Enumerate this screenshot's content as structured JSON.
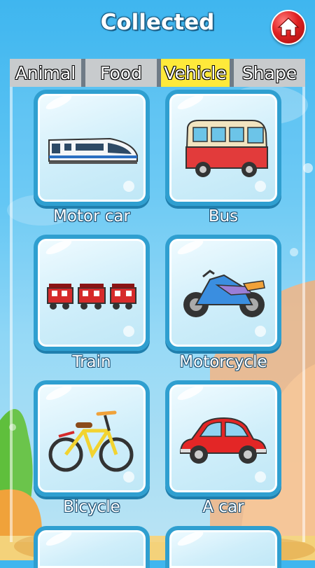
{
  "header": {
    "title": "Collected",
    "home_icon": "home-icon"
  },
  "tabs": [
    {
      "label": "Animal",
      "active": false
    },
    {
      "label": "Food",
      "active": false
    },
    {
      "label": "Vehicle",
      "active": true
    },
    {
      "label": "Shape",
      "active": false
    }
  ],
  "items": [
    {
      "label": "Motor car",
      "icon": "train-icon"
    },
    {
      "label": "Bus",
      "icon": "bus-icon"
    },
    {
      "label": "Train",
      "icon": "steam-train-icon"
    },
    {
      "label": "Motorcycle",
      "icon": "motorcycle-icon"
    },
    {
      "label": "Bicycle",
      "icon": "bicycle-icon"
    },
    {
      "label": "A car",
      "icon": "car-icon"
    }
  ],
  "colors": {
    "active_tab": "#ffe93a",
    "inactive_tab": "#c8cbcd",
    "card_border": "#2f9fd0",
    "home_button": "#e02222"
  }
}
